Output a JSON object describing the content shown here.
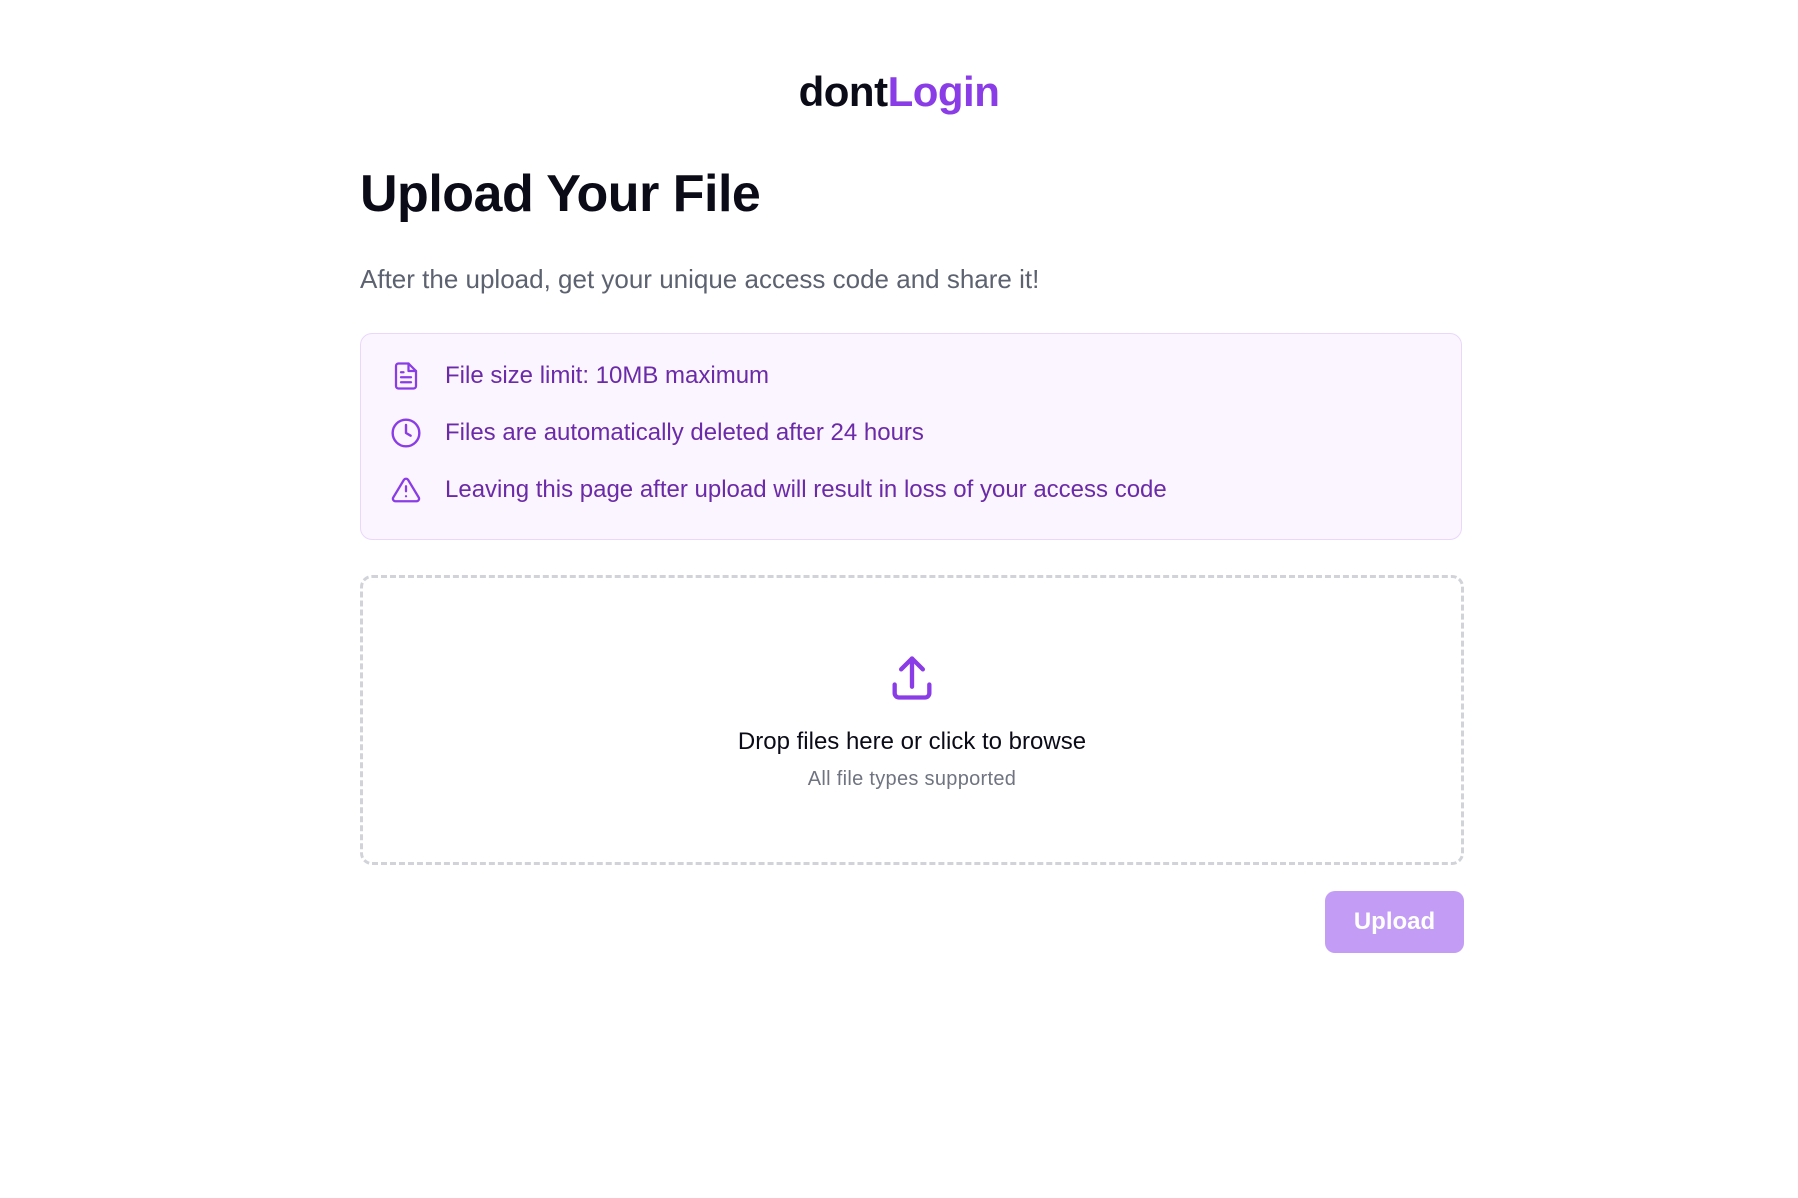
{
  "brand": {
    "part1": "dont",
    "part2": "Login"
  },
  "heading": {
    "title": "Upload Your File",
    "subtitle": "After the upload, get your unique access code and share it!"
  },
  "info": {
    "items": [
      {
        "icon": "document-icon",
        "text": "File size limit: 10MB maximum"
      },
      {
        "icon": "clock-icon",
        "text": "Files are automatically deleted after 24 hours"
      },
      {
        "icon": "warning-icon",
        "text": "Leaving this page after upload will result in loss of your access code"
      }
    ]
  },
  "dropzone": {
    "icon": "upload-icon",
    "main_text": "Drop files here or click to browse",
    "sub_text": "All file types supported"
  },
  "actions": {
    "upload_label": "Upload"
  },
  "colors": {
    "accent": "#8a3ce6",
    "info_text": "#6b2aa8",
    "info_bg": "#faf5fe",
    "button_disabled": "#c29cf5"
  }
}
